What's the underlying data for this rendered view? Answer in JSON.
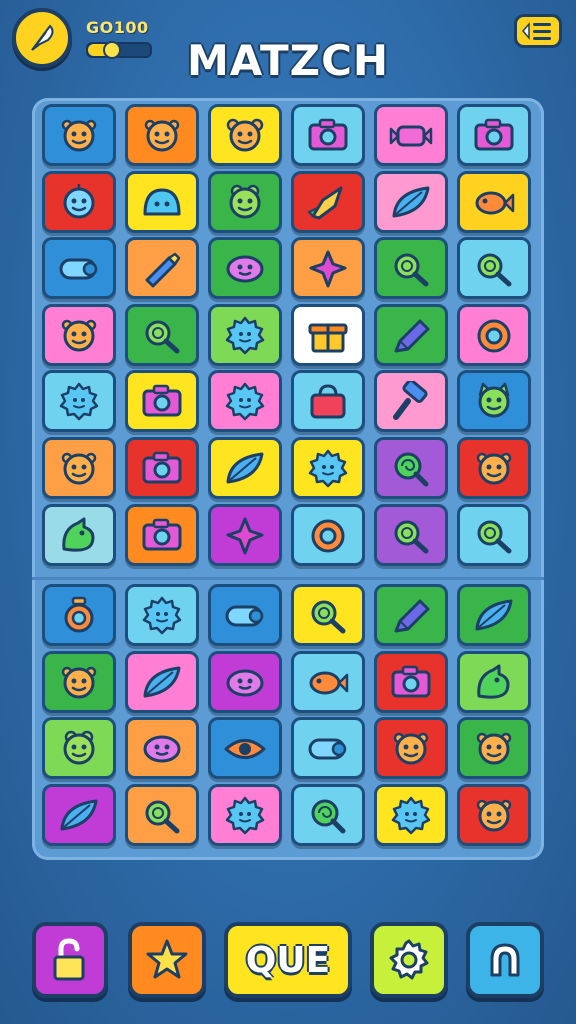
{
  "header": {
    "title": "MATZCH",
    "gold_label": "GO100",
    "progress_fraction": 0.35,
    "logo_icon": "feather-coin-icon",
    "menu_icon": "menu-list-icon"
  },
  "colors": {
    "background": "#2f6fae",
    "accent": "#ffd21f",
    "outline": "#1c3f66"
  },
  "board": {
    "columns": 6,
    "rows": [
      [
        {
          "color": "#2f8fd8",
          "icon": "monster-face"
        },
        {
          "color": "#ff8a1f",
          "icon": "monster-face"
        },
        {
          "color": "#ffe51f",
          "icon": "bear-face"
        },
        {
          "color": "#6fd3f0",
          "icon": "camera"
        },
        {
          "color": "#ff7fd4",
          "icon": "candy"
        },
        {
          "color": "#6fd3f0",
          "icon": "camera"
        }
      ],
      [
        {
          "color": "#e8332c",
          "icon": "robot-face"
        },
        {
          "color": "#ffe51f",
          "icon": "ghost-slime"
        },
        {
          "color": "#39b54a",
          "icon": "frog-face"
        },
        {
          "color": "#e8332c",
          "icon": "rocket"
        },
        {
          "color": "#ff9ad0",
          "icon": "leaf"
        },
        {
          "color": "#ffd21f",
          "icon": "fish"
        }
      ],
      [
        {
          "color": "#2f8fd8",
          "icon": "cannon"
        },
        {
          "color": "#ff9f45",
          "icon": "crayon"
        },
        {
          "color": "#39b54a",
          "icon": "blob-face"
        },
        {
          "color": "#ff9f45",
          "icon": "star-gem"
        },
        {
          "color": "#39b54a",
          "icon": "magnifier"
        },
        {
          "color": "#6fd3f0",
          "icon": "magnifier"
        }
      ],
      [
        {
          "color": "#ff7fd4",
          "icon": "monster-face"
        },
        {
          "color": "#39b54a",
          "icon": "magnifier"
        },
        {
          "color": "#7ed957",
          "icon": "gear-face"
        },
        {
          "color": "#ffffff",
          "icon": "gift-box"
        },
        {
          "color": "#39b54a",
          "icon": "pencil"
        },
        {
          "color": "#ff7fd4",
          "icon": "lifebuoy"
        }
      ],
      [
        {
          "color": "#6fd3f0",
          "icon": "gear-face"
        },
        {
          "color": "#ffe51f",
          "icon": "camera"
        },
        {
          "color": "#ff7fd4",
          "icon": "gear-face"
        },
        {
          "color": "#6fd3f0",
          "icon": "bag"
        },
        {
          "color": "#ff9ad0",
          "icon": "hammer"
        },
        {
          "color": "#2f8fd8",
          "icon": "cat-face"
        }
      ],
      [
        {
          "color": "#ff9f45",
          "icon": "monster-face"
        },
        {
          "color": "#e8332c",
          "icon": "camera"
        },
        {
          "color": "#ffe51f",
          "icon": "leaf"
        },
        {
          "color": "#ffe51f",
          "icon": "gear-face"
        },
        {
          "color": "#a35ad6",
          "icon": "lollipop"
        },
        {
          "color": "#e8332c",
          "icon": "monster-face"
        }
      ],
      [
        {
          "color": "#9adbe8",
          "icon": "dragon"
        },
        {
          "color": "#ff8a1f",
          "icon": "camera"
        },
        {
          "color": "#c13cd6",
          "icon": "star-gem"
        },
        {
          "color": "#6fd3f0",
          "icon": "lifebuoy"
        },
        {
          "color": "#a35ad6",
          "icon": "magnifier"
        },
        {
          "color": "#6fd3f0",
          "icon": "magnifier"
        }
      ],
      [
        {
          "color": "#2f8fd8",
          "icon": "lantern"
        },
        {
          "color": "#6fd3f0",
          "icon": "gear-face"
        },
        {
          "color": "#2f8fd8",
          "icon": "cannon"
        },
        {
          "color": "#ffe51f",
          "icon": "magnifier"
        },
        {
          "color": "#39b54a",
          "icon": "pencil"
        },
        {
          "color": "#39b54a",
          "icon": "leaf"
        }
      ],
      [
        {
          "color": "#39b54a",
          "icon": "monster-face"
        },
        {
          "color": "#ff7fd4",
          "icon": "leaf"
        },
        {
          "color": "#c13cd6",
          "icon": "blob-face"
        },
        {
          "color": "#6fd3f0",
          "icon": "fish"
        },
        {
          "color": "#e8332c",
          "icon": "camera"
        },
        {
          "color": "#7ed957",
          "icon": "dragon"
        }
      ],
      [
        {
          "color": "#7ed957",
          "icon": "frog-face"
        },
        {
          "color": "#ff9f45",
          "icon": "blob-face"
        },
        {
          "color": "#2f8fd8",
          "icon": "eye"
        },
        {
          "color": "#6fd3f0",
          "icon": "cannon"
        },
        {
          "color": "#e8332c",
          "icon": "monster-face"
        },
        {
          "color": "#39b54a",
          "icon": "monster-face"
        }
      ],
      [
        {
          "color": "#c13cd6",
          "icon": "leaf"
        },
        {
          "color": "#ff9f45",
          "icon": "magnifier"
        },
        {
          "color": "#ff7fd4",
          "icon": "gear-face"
        },
        {
          "color": "#6fd3f0",
          "icon": "lollipop"
        },
        {
          "color": "#ffe51f",
          "icon": "gear-face"
        },
        {
          "color": "#e8332c",
          "icon": "monster-face"
        }
      ]
    ]
  },
  "bottom_bar": {
    "unlock": {
      "color": "#c13cd6",
      "icon": "unlock-icon"
    },
    "star": {
      "color": "#ff8a1f",
      "icon": "star-icon"
    },
    "que": {
      "color": "#ffe51f",
      "label": "QUE"
    },
    "settings": {
      "color": "#c6f03a",
      "icon": "gear-icon"
    },
    "magnet": {
      "color": "#3db4e8",
      "icon": "magnet-icon"
    }
  }
}
